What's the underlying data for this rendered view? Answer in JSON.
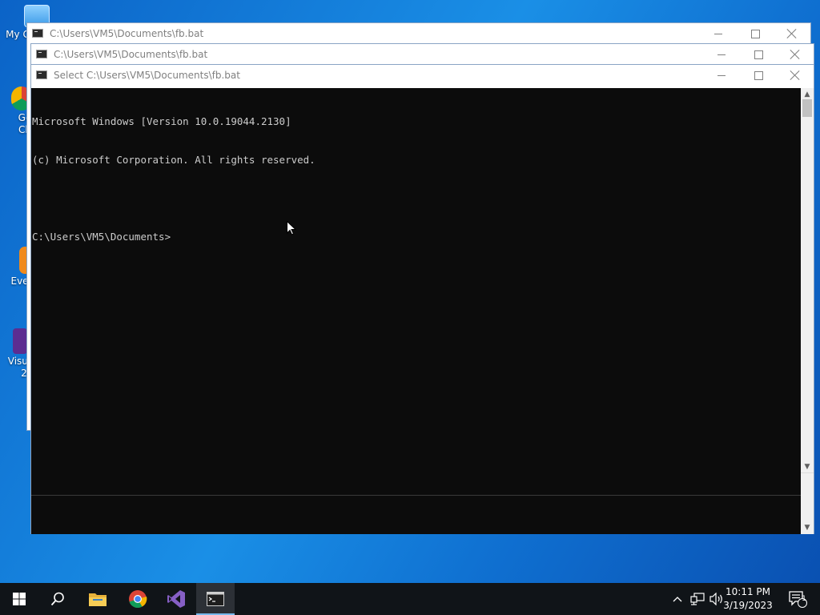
{
  "desktop": {
    "icons": [
      {
        "label": "My C",
        "icon": "my-computer-icon"
      },
      {
        "label": "Go",
        "sublabel": "Ch",
        "icon": "chrome-shortcut-icon"
      },
      {
        "label": "Ever",
        "icon": "everything-shortcut-icon"
      },
      {
        "label": "Visua",
        "sublabel": "2",
        "icon": "visual-studio-shortcut-icon"
      }
    ]
  },
  "windows": [
    {
      "title": "C:\\Users\\VM5\\Documents\\fb.bat"
    },
    {
      "title": "C:\\Users\\VM5\\Documents\\fb.bat"
    },
    {
      "title": "Select C:\\Users\\VM5\\Documents\\fb.bat"
    }
  ],
  "console": {
    "lines": [
      "Microsoft Windows [Version 10.0.19044.2130]",
      "(c) Microsoft Corporation. All rights reserved.",
      "",
      "C:\\Users\\VM5\\Documents>"
    ]
  },
  "taskbar": {
    "items": [
      "start-icon",
      "search-icon",
      "file-explorer-icon",
      "chrome-icon",
      "visual-studio-icon",
      "command-prompt-icon"
    ],
    "active": "command-prompt-icon",
    "clock_time": "10:11 PM",
    "clock_date": "3/19/2023",
    "notification_count": "1"
  },
  "colors": {
    "console_bg": "#0c0c0c",
    "console_fg": "#cccccc",
    "taskbar_bg": "#101418",
    "accent": "#76b9ed"
  }
}
